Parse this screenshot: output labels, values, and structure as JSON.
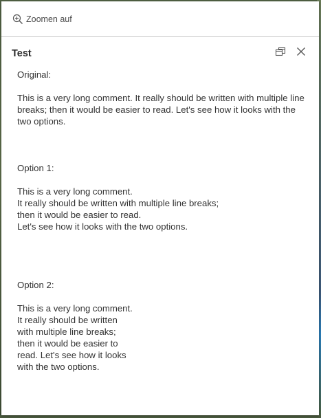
{
  "action_bar": {
    "zoom_label": "Zoomen auf",
    "zoom_icon": "zoom-in-icon"
  },
  "popup": {
    "title": "Test",
    "dock_icon": "dock-icon",
    "close_icon": "close-icon"
  },
  "content": {
    "original_heading": "Original:",
    "original_text": "This is a very long comment. It really should be written with multiple line breaks; then it would be easier to read. Let's see how it looks with the two options.",
    "option1_heading": "Option 1:",
    "option1_text": "This is a very long comment.\nIt really should be written with multiple line breaks;\nthen it would be easier to read.\nLet's see how it looks with the two options.",
    "option2_heading": "Option 2:",
    "option2_text": "This is a very long comment. It really should be written with multiple line breaks; then it would be easier to read. Let's see how it looks with the two options."
  }
}
